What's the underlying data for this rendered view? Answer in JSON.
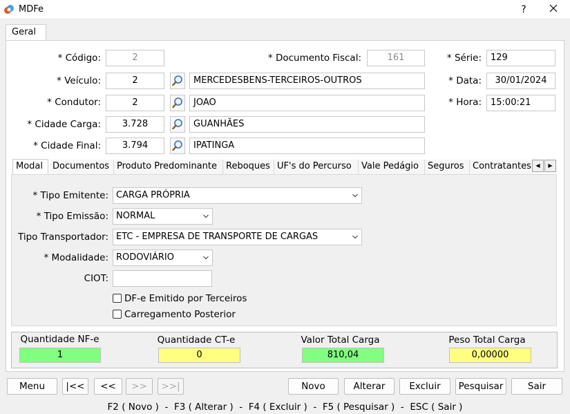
{
  "window": {
    "title": "MDFe",
    "help": "?",
    "close": "✕"
  },
  "main_tab": "Geral",
  "form": {
    "codigo": {
      "label": "* Código:",
      "value": "2"
    },
    "documento_fiscal": {
      "label": "* Documento Fiscal:",
      "value": "161"
    },
    "serie": {
      "label": "* Série:",
      "value": "129"
    },
    "veiculo": {
      "label": "* Veículo:",
      "value": "2",
      "desc": "MERCEDESBENS-TERCEIROS-OUTROS"
    },
    "data": {
      "label": "* Data:",
      "value": "30/01/2024"
    },
    "condutor": {
      "label": "* Condutor:",
      "value": "2",
      "desc": "JOAO"
    },
    "hora": {
      "label": "* Hora:",
      "value": "15:00:21"
    },
    "cidade_carga": {
      "label": "* Cidade Carga:",
      "value": "3.728",
      "desc": "GUANHÃES"
    },
    "cidade_final": {
      "label": "* Cidade Final:",
      "value": "3.794",
      "desc": "IPATINGA"
    }
  },
  "sub_tabs": [
    "Modal",
    "Documentos",
    "Produto Predominante",
    "Reboques",
    "UF's do Percurso",
    "Vale Pedágio",
    "Seguros",
    "Contratantes"
  ],
  "scroll": {
    "left": "◀",
    "right": "▶"
  },
  "modal": {
    "tipo_emitente": {
      "label": "* Tipo Emitente:",
      "value": "CARGA PRÓPRIA"
    },
    "tipo_emissao": {
      "label": "* Tipo Emissão:",
      "value": "NORMAL"
    },
    "tipo_transportador": {
      "label": "Tipo Transportador:",
      "value": "ETC - EMPRESA DE TRANSPORTE DE CARGAS"
    },
    "modalidade": {
      "label": "* Modalidade:",
      "value": "RODOVIÁRIO"
    },
    "ciot": {
      "label": "CIOT:",
      "value": ""
    },
    "dfe_terceiros": {
      "label": "DF-e Emitido por Terceiros",
      "checked": false
    },
    "carregamento_posterior": {
      "label": "Carregamento Posterior",
      "checked": false
    }
  },
  "totals": {
    "qtd_nfe": {
      "label": "Quantidade NF-e",
      "value": "1",
      "color": "#80ff80"
    },
    "qtd_cte": {
      "label": "Quantidade CT-e",
      "value": "0",
      "color": "#ffff80"
    },
    "valor_total": {
      "label": "Valor Total Carga",
      "value": "810,04",
      "color": "#80ff80"
    },
    "peso_total": {
      "label": "Peso Total Carga",
      "value": "0,00000",
      "color": "#ffff80"
    }
  },
  "buttons": {
    "menu": "Menu",
    "first": "|<<",
    "prev": "<<",
    "next": ">>",
    "last": ">>|",
    "novo": "Novo",
    "alterar": "Alterar",
    "excluir": "Excluir",
    "pesquisar": "Pesquisar",
    "sair": "Sair"
  },
  "shortcuts": "F2 ( Novo )  -  F3 ( Alterar )  -  F4 ( Excluir )  -  F5 ( Pesquisar )  -  ESC ( Sair )"
}
